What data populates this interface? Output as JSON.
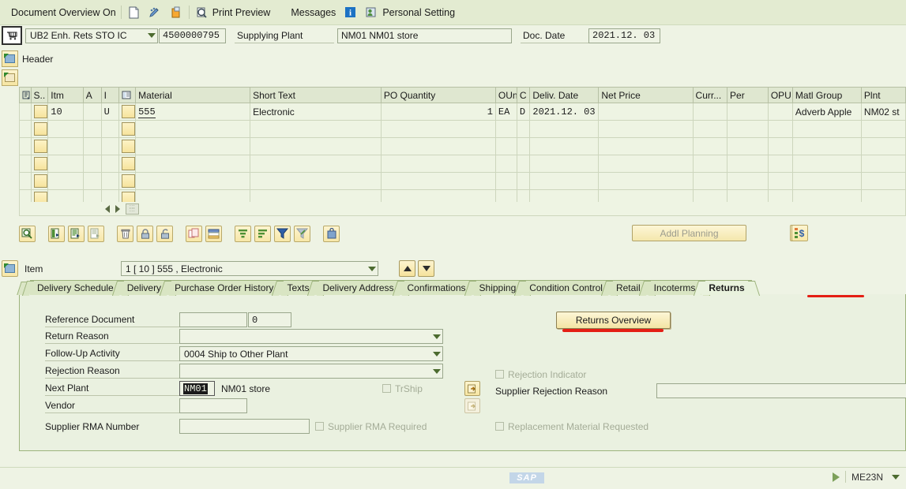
{
  "toolbar": {
    "document_overview": "Document Overview On",
    "icons": [
      "new-document-icon",
      "edit-pencil-icon",
      "hold-document-icon"
    ],
    "print_preview": "Print Preview",
    "messages": "Messages",
    "info_icon": "info-icon",
    "personal_setting": "Personal Setting"
  },
  "header": {
    "cart_icon": "shopping-cart-icon",
    "doc_type": "UB2 Enh. Rets STO IC",
    "doc_number": "4500000795",
    "supplying_plant_label": "Supplying Plant",
    "supplying_plant_value": "NM01 NM01 store",
    "doc_date_label": "Doc. Date",
    "doc_date_value": "2021.12. 03",
    "header_label": "Header"
  },
  "grid": {
    "columns": [
      "",
      "S..",
      "Itm",
      "A",
      "I",
      "",
      "Material",
      "Short Text",
      "PO Quantity",
      "OUn",
      "C",
      "Deliv. Date",
      "Net Price",
      "Curr...",
      "Per",
      "OPU",
      "Matl Group",
      "Plnt"
    ],
    "rows": [
      {
        "itm": "10",
        "a": "",
        "i": "U",
        "material": "555",
        "short_text": "Electronic",
        "po_quantity": "1",
        "oun": "EA",
        "c": "D",
        "deliv_date": "2021.12. 03",
        "net_price": "",
        "curr": "",
        "per": "",
        "opu": "",
        "matl_group": "Adverb Apple",
        "plnt": "NM02 st"
      }
    ],
    "empty_row_count": 5
  },
  "actions": {
    "icons": [
      "detail-magnifier-icon",
      "insert-line-icon",
      "copy-line-icon",
      "paste-line-icon",
      "delete-trash-icon",
      "lock-icon",
      "unlock-icon",
      "duplicate-icon",
      "table-settings-icon",
      "sort-ascending-icon",
      "sort-descending-icon",
      "filter-icon",
      "filter-clear-icon",
      "print-bag-icon",
      "configure-icon"
    ],
    "addl_planning": "Addl Planning",
    "right_icon": "account-assignment-icon"
  },
  "item_selector": {
    "icon": "item-detail-icon",
    "label": "Item",
    "value": "1 [ 10 ] 555 , Electronic",
    "prev_icon": "arrow-up-icon",
    "next_icon": "arrow-down-icon"
  },
  "tabs": [
    {
      "label": "Delivery Schedule",
      "active": false
    },
    {
      "label": "Delivery",
      "active": false
    },
    {
      "label": "Purchase Order History",
      "active": false
    },
    {
      "label": "Texts",
      "active": false
    },
    {
      "label": "Delivery Address",
      "active": false
    },
    {
      "label": "Confirmations",
      "active": false
    },
    {
      "label": "Shipping",
      "active": false
    },
    {
      "label": "Condition Control",
      "active": false
    },
    {
      "label": "Retail",
      "active": false
    },
    {
      "label": "Incoterms",
      "active": false
    },
    {
      "label": "Returns",
      "active": true
    }
  ],
  "returns_form": {
    "reference_document_label": "Reference Document",
    "reference_document_value": "",
    "reference_document_item": "0",
    "return_reason_label": "Return Reason",
    "return_reason_value": "",
    "follow_up_activity_label": "Follow-Up Activity",
    "follow_up_activity_value": "0004 Ship to Other Plant",
    "rejection_reason_label": "Rejection Reason",
    "rejection_reason_value": "",
    "next_plant_label": "Next Plant",
    "next_plant_value": "NM01",
    "next_plant_desc": "NM01 store",
    "trship_label": "TrShip",
    "vendor_label": "Vendor",
    "vendor_value": "",
    "supplier_rma_label": "Supplier RMA Number",
    "supplier_rma_value": "",
    "supplier_rma_required_label": "Supplier RMA Required",
    "returns_overview_button": "Returns Overview",
    "rejection_indicator_label": "Rejection Indicator",
    "supplier_rejection_reason_label": "Supplier Rejection Reason",
    "supplier_rejection_reason_value": "",
    "replacement_material_label": "Replacement Material Requested",
    "next_plant_help_icon": "value-help-arrow-icon",
    "vendor_help_icon": "value-help-arrow-icon"
  },
  "status_bar": {
    "logo": "SAP",
    "play_icon": "server-status-icon",
    "transaction_code": "ME23N",
    "tcode_caret": "chevron-down-icon"
  },
  "colors": {
    "background": "#eaf1e0",
    "toolbar": "#e3ebd1",
    "grid_header": "#dfe7d0",
    "annotation_red": "#e41e14",
    "button_yellow": "#f5e5a8",
    "tab_active": "#e9f2dd"
  }
}
